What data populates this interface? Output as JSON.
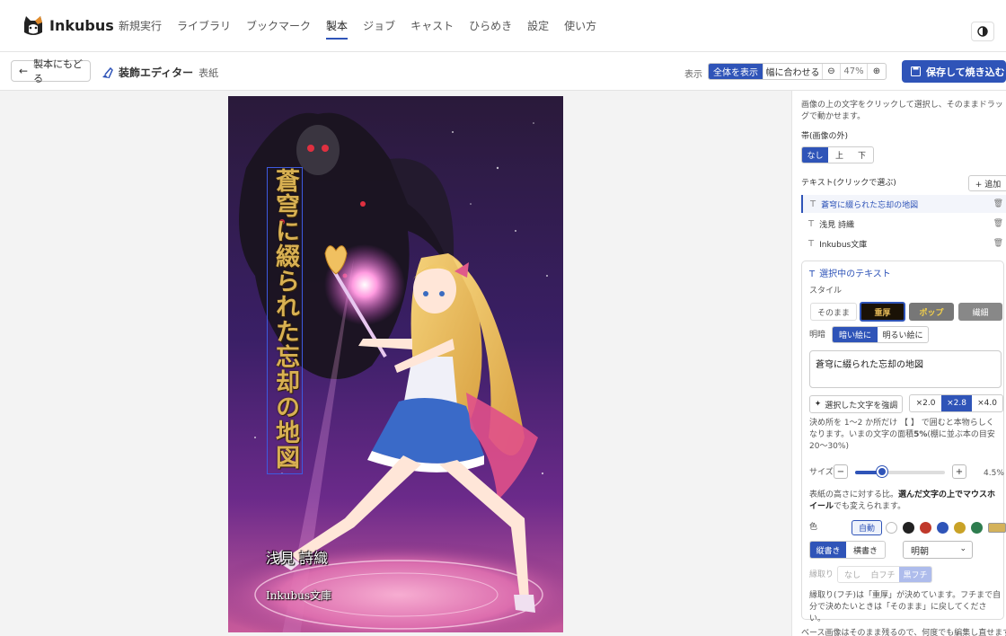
{
  "app": {
    "name": "Inkubus"
  },
  "nav": {
    "items": [
      "新規実行",
      "ライブラリ",
      "ブックマーク",
      "製本",
      "ジョブ",
      "キャスト",
      "ひらめき",
      "設定",
      "使い方"
    ],
    "active_index": 3
  },
  "toolbar": {
    "back_label": "製本にもどる",
    "editor_title": "装飾エディター",
    "editor_sub": "表紙",
    "view_label": "表示",
    "fit_all_label": "全体を表示",
    "fit_width_label": "幅に合わせる",
    "zoom": "47%",
    "save_label": "保存して焼き込む"
  },
  "cover": {
    "title": "蒼穹に綴られた忘却の地図",
    "author": "浅見 詩織",
    "publisher": "Inkubus文庫"
  },
  "panel": {
    "hint": "画像の上の文字をクリックして選択し、そのままドラッグで動かせます。",
    "band_label": "帯(画像の外)",
    "band_options": [
      "なし",
      "上",
      "下"
    ],
    "band_selected": 0,
    "texts_label": "テキスト(クリックで選ぶ)",
    "add_label": "+ 追加",
    "texts": [
      "蒼穹に綴られた忘却の地図",
      "浅見 詩織",
      "Inkubus文庫"
    ],
    "selected_text_index": 0,
    "card": {
      "header": "選択中のテキスト",
      "style_label": "スタイル",
      "styles": [
        "そのまま",
        "重厚",
        "ポップ",
        "繊細"
      ],
      "style_selected": 1,
      "contrast_label": "明暗",
      "contrast_options": [
        "暗い絵に",
        "明るい絵に"
      ],
      "contrast_selected": 0,
      "text_value": "蒼穹に綴られた忘却の地図",
      "emphasize_label": "選択した文字を強調",
      "scale_options": [
        "×2.0",
        "×2.8",
        "×4.0"
      ],
      "scale_selected": 1,
      "emphasize_note_a": "決め所を 1〜2 か所だけ 【 】 で囲むと本物らしくなります。いまの文字の面積",
      "emphasize_note_pct": "5%",
      "emphasize_note_b": "(棚に並ぶ本の目安 20〜30%)",
      "size_label": "サイズ",
      "size_value": "4.5%",
      "size_fraction": 0.3,
      "size_note_a": "表紙の高さに対する比。",
      "size_note_b": "選んだ文字の上でマウスホイール",
      "size_note_c": "でも変えられます。",
      "color_label": "色",
      "color_auto_label": "自動",
      "colors": [
        "#ffffff",
        "#222222",
        "#c0392b",
        "#2f54b8",
        "#c9a227",
        "#2e7d4f",
        "#d4b25a"
      ],
      "writing_options": [
        "縦書き",
        "横書き"
      ],
      "writing_selected": 0,
      "font_value": "明朝",
      "outline_label": "縁取り",
      "outline_options": [
        "なし",
        "白フチ",
        "黒フチ"
      ],
      "outline_selected": 2,
      "outline_note": "縁取り(フチ)は「重厚」が決めています。フチまで自分で決めたいときは「そのまま」に戻してください。"
    },
    "footer_note": "ベース画像はそのまま残るので、何度でも編集し直せます。文"
  },
  "colors": {
    "accent": "#2f54b8"
  }
}
